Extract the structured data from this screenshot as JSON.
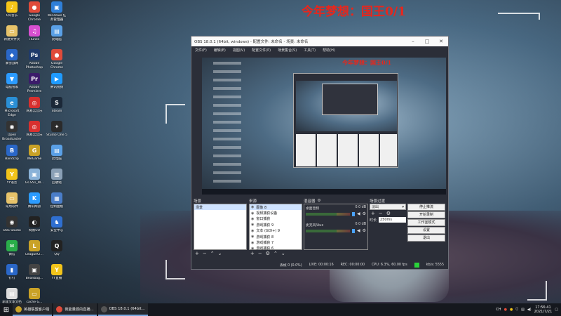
{
  "wallpaper_title": "今年梦想：国王0/1",
  "desktop_icons": [
    {
      "label": "QQ音乐",
      "color": "#f5c518",
      "glyph": "♪"
    },
    {
      "label": "Google Chrome",
      "color": "#e04b3a",
      "glyph": "●"
    },
    {
      "label": "Windows 任务管理器",
      "color": "#2f7fd8",
      "glyph": "▣"
    },
    {
      "label": "新建文件夹",
      "color": "#e7c36a",
      "glyph": "▭"
    },
    {
      "label": "iTunes",
      "color": "#d84fd0",
      "glyph": "♫"
    },
    {
      "label": "此电脑",
      "color": "#5aa0e6",
      "glyph": "▤"
    },
    {
      "label": "暴雪战网",
      "color": "#2a67c8",
      "glyph": "◆"
    },
    {
      "label": "Adobe Photoshop",
      "color": "#1f3a6b",
      "glyph": "Ps"
    },
    {
      "label": "Google Chrome",
      "color": "#e04b3a",
      "glyph": "●"
    },
    {
      "label": "电脑管家",
      "color": "#2b9bff",
      "glyph": "▼"
    },
    {
      "label": "Adobe Premiere",
      "color": "#3b1b6a",
      "glyph": "Pr"
    },
    {
      "label": "腾讯视频",
      "color": "#1f9bff",
      "glyph": "▶"
    },
    {
      "label": "Microsoft Edge",
      "color": "#2a8fd6",
      "glyph": "e"
    },
    {
      "label": "网易云音乐",
      "color": "#d8302f",
      "glyph": "◎"
    },
    {
      "label": "Steam",
      "color": "#1b2838",
      "glyph": "S"
    },
    {
      "label": "Open Broadcaster",
      "color": "#333",
      "glyph": "◉"
    },
    {
      "label": "网易云音乐",
      "color": "#d8302f",
      "glyph": "◎"
    },
    {
      "label": "Studio One 5",
      "color": "#2b2b2b",
      "glyph": "✦"
    },
    {
      "label": "Bandizip",
      "color": "#2a67c8",
      "glyph": "B"
    },
    {
      "label": "WeGame",
      "color": "#c9a227",
      "glyph": "G"
    },
    {
      "label": "此电脑",
      "color": "#5aa0e6",
      "glyph": "▤"
    },
    {
      "label": "YY语音",
      "color": "#f2c41a",
      "glyph": "Y"
    },
    {
      "label": "GCS51_W...",
      "color": "#8ab2d8",
      "glyph": "▣"
    },
    {
      "label": "回收站",
      "color": "#8aa0b6",
      "glyph": "▥"
    },
    {
      "label": "常用软件",
      "color": "#e7c36a",
      "glyph": "▭"
    },
    {
      "label": "腾讯网游",
      "color": "#2b9bff",
      "glyph": "K"
    },
    {
      "label": "控制面板",
      "color": "#4a7dc8",
      "glyph": "▦"
    },
    {
      "label": "OBS Studio",
      "color": "#333",
      "glyph": "◉"
    },
    {
      "label": "网易UU",
      "color": "#222",
      "glyph": "◐"
    },
    {
      "label": "安全中心",
      "color": "#2f6fd0",
      "glyph": "♞"
    },
    {
      "label": "微信",
      "color": "#2aae4a",
      "glyph": "✉"
    },
    {
      "label": "LeagueCl...",
      "color": "#c9a227",
      "glyph": "L"
    },
    {
      "label": "QQ",
      "color": "#222",
      "glyph": "Q"
    },
    {
      "label": "钉钉",
      "color": "#2a67c8",
      "glyph": "▮"
    },
    {
      "label": "Beanbag...",
      "color": "#444",
      "glyph": "▣"
    },
    {
      "label": "YY直播",
      "color": "#f2c41a",
      "glyph": "Y"
    },
    {
      "label": "新建文本文档",
      "color": "#ddd",
      "glyph": "▤"
    },
    {
      "label": "cache G...",
      "color": "#c9a227",
      "glyph": "▭"
    }
  ],
  "obs": {
    "title": "OBS 18.0.1 (64bit, windows) - 配置文件: 未命名 - 场景: 未命名",
    "menu": [
      "文件(F)",
      "编辑(E)",
      "视图(V)",
      "配置文件(P)",
      "场景集合(S)",
      "工具(T)",
      "帮助(H)"
    ],
    "preview_title": "今年梦想：国王0/1",
    "docks": {
      "scenes": {
        "title": "场景",
        "items": [
          "场景"
        ]
      },
      "sources": {
        "title": "来源",
        "items": [
          "图像 8",
          "视频捕获设备",
          "窗口捕获",
          "游戏捕获 9",
          "文本 (GDI+) 9",
          "游戏捕获 8",
          "游戏捕获 7",
          "游戏捕获 6"
        ]
      },
      "mixer": {
        "title": "混音器",
        "channels": [
          {
            "name": "桌面音频",
            "level": "0.0 dB"
          },
          {
            "name": "麦克风/Aux",
            "level": "0.0 dB"
          }
        ]
      },
      "transitions": {
        "title": "场景过渡",
        "type": "淡出",
        "duration_label": "时长",
        "duration": "250ms"
      },
      "controls": [
        "停止推流",
        "开始录制",
        "工作室模式",
        "设置",
        "退出"
      ]
    },
    "status": {
      "dropped": "丢帧 0 (0.0%)",
      "live": "LIVE: 00:00:16",
      "rec": "REC: 00:00:00",
      "cpu": "CPU: 6.3%, 60.00 fps",
      "bitrate": "kb/s: 5555"
    }
  },
  "taskbar": {
    "apps": [
      {
        "label": "英雄联盟客户端",
        "color": "#c9a227"
      },
      {
        "label": "我能量源的直播...",
        "color": "#e04b3a"
      },
      {
        "label": "OBS 18.0.1 (64bit...",
        "color": "#555"
      }
    ],
    "tray_text": "CH",
    "time": "17:56:41",
    "date": "2021/7/21"
  }
}
